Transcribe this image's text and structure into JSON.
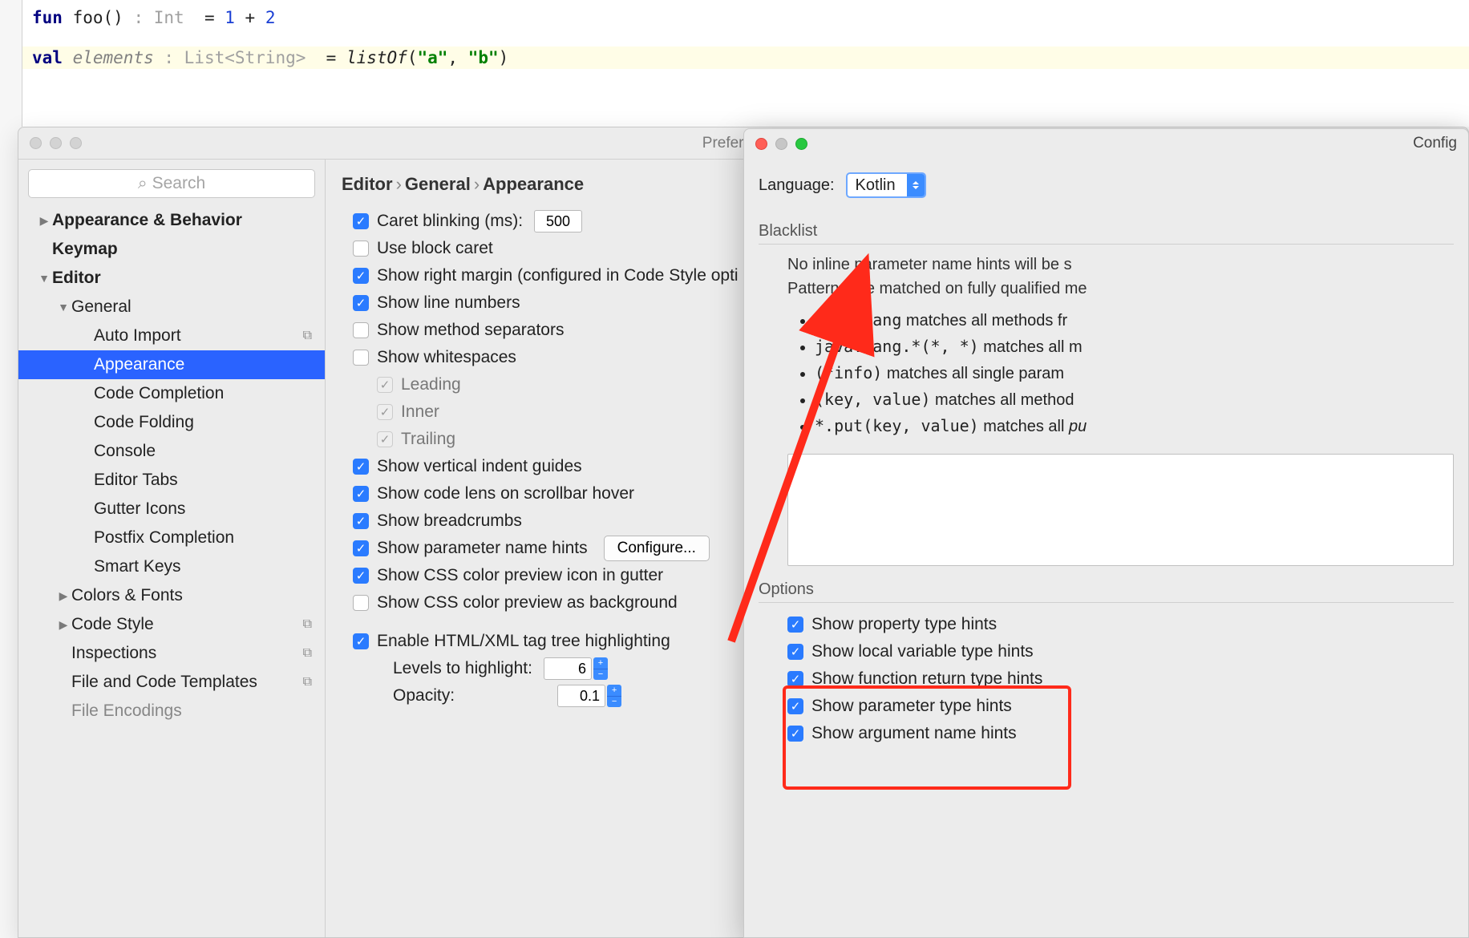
{
  "code": {
    "line1_kw": "fun",
    "line1_fn": " foo()",
    "line1_hint": " : Int ",
    "line1_rest": " = ",
    "line1_n1": "1",
    "line1_plus": " + ",
    "line1_n2": "2",
    "line2_kw": "val",
    "line2_id": " elements",
    "line2_hint": " : List<String> ",
    "line2_eq": " = ",
    "line2_call": "listOf",
    "line2_p1": "(",
    "line2_s1": "\"a\"",
    "line2_c": ", ",
    "line2_s2": "\"b\"",
    "line2_p2": ")"
  },
  "prefs": {
    "title": "Preferences",
    "search_placeholder": "Search",
    "tree": {
      "appearance_behavior": "Appearance & Behavior",
      "keymap": "Keymap",
      "editor": "Editor",
      "general": "General",
      "auto_import": "Auto Import",
      "appearance": "Appearance",
      "code_completion": "Code Completion",
      "code_folding": "Code Folding",
      "console": "Console",
      "editor_tabs": "Editor Tabs",
      "gutter_icons": "Gutter Icons",
      "postfix_completion": "Postfix Completion",
      "smart_keys": "Smart Keys",
      "colors_fonts": "Colors & Fonts",
      "code_style": "Code Style",
      "inspections": "Inspections",
      "file_code_templates": "File and Code Templates",
      "file_encodings": "File Encodings"
    },
    "breadcrumbs": {
      "a": "Editor",
      "b": "General",
      "c": "Appearance"
    },
    "opts": {
      "caret_blinking": "Caret blinking (ms):",
      "caret_blinking_val": "500",
      "use_block_caret": "Use block caret",
      "right_margin": "Show right margin (configured in Code Style opti",
      "line_numbers": "Show line numbers",
      "method_sep": "Show method separators",
      "whitespaces": "Show whitespaces",
      "leading": "Leading",
      "inner": "Inner",
      "trailing": "Trailing",
      "indent_guides": "Show vertical indent guides",
      "code_lens": "Show code lens on scrollbar hover",
      "breadcrumbs": "Show breadcrumbs",
      "param_hints": "Show parameter name hints",
      "configure_btn": "Configure...",
      "css_gutter": "Show CSS color preview icon in gutter",
      "css_bg": "Show CSS color preview as background",
      "html_tree": "Enable HTML/XML tag tree highlighting",
      "levels": "Levels to highlight:",
      "levels_val": "6",
      "opacity": "Opacity:",
      "opacity_val": "0.1"
    }
  },
  "config": {
    "title": "Config",
    "language_label": "Language:",
    "language_value": "Kotlin",
    "blacklist_label": "Blacklist",
    "bl_line1": "No inline parameter name hints will be s",
    "bl_line2": "Patterns are matched on fully qualified me",
    "bullet1_code": "java.lang",
    "bullet1_rest": " matches all methods fr",
    "bullet2_code": "java.lang.*(*, *)",
    "bullet2_rest": " matches all m",
    "bullet3_code": "(*info)",
    "bullet3_rest": " matches all single param",
    "bullet4_code": "(key, value)",
    "bullet4_rest": " matches all method",
    "bullet5_code": "*.put(key, value)",
    "bullet5_rest": " matches all ",
    "bullet5_i": "pu",
    "options_label": "Options",
    "opt1": "Show property type hints",
    "opt2": "Show local variable type hints",
    "opt3": "Show function return type hints",
    "opt4": "Show parameter type hints",
    "opt5": "Show argument name hints"
  }
}
